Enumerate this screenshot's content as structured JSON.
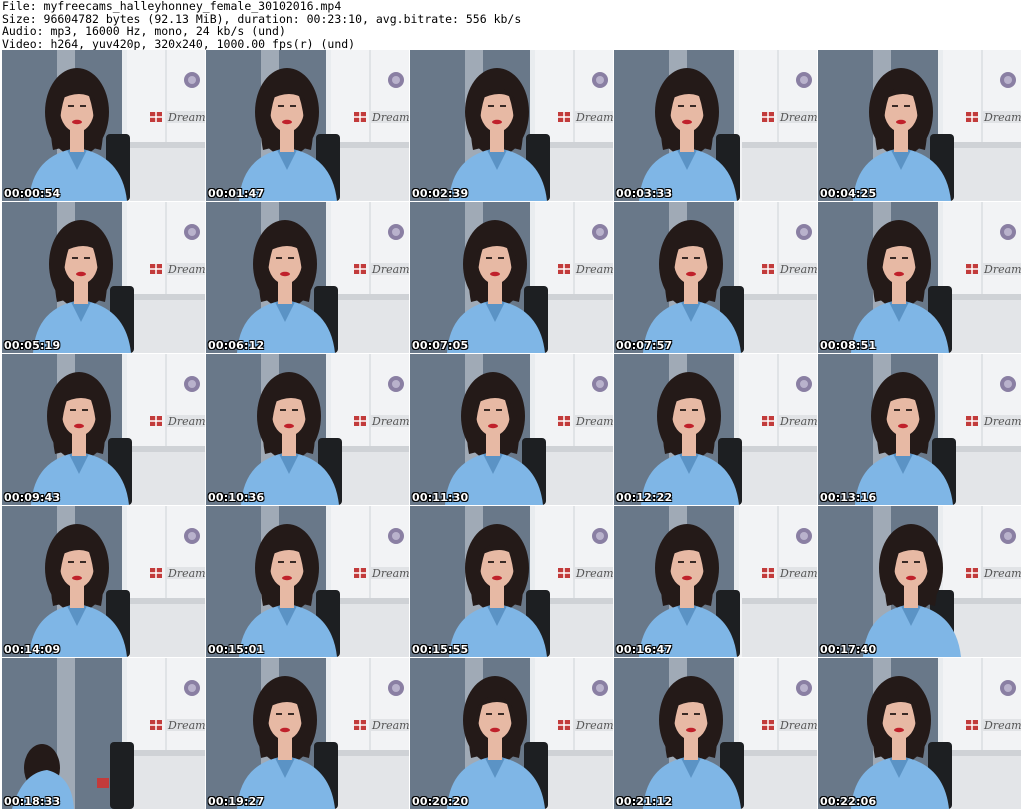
{
  "header": {
    "file": "File: myfreecams_halleyhonney_female_30102016.mp4",
    "size": "Size: 96604782 bytes (92.13 MiB), duration: 00:23:10, avg.bitrate: 556 kb/s",
    "audio": "Audio: mp3, 16000 Hz, mono, 24 kb/s (und)",
    "video": "Video: h264, yuv420p, 320x240, 1000.00 fps(r) (und)"
  },
  "thumbnails": [
    {
      "timestamp": "00:00:54",
      "icon": "webcam-frame"
    },
    {
      "timestamp": "00:01:47",
      "icon": "webcam-frame"
    },
    {
      "timestamp": "00:02:39",
      "icon": "webcam-frame"
    },
    {
      "timestamp": "00:03:33",
      "icon": "webcam-frame"
    },
    {
      "timestamp": "00:04:25",
      "icon": "webcam-frame"
    },
    {
      "timestamp": "00:05:19",
      "icon": "webcam-frame"
    },
    {
      "timestamp": "00:06:12",
      "icon": "webcam-frame"
    },
    {
      "timestamp": "00:07:05",
      "icon": "webcam-frame"
    },
    {
      "timestamp": "00:07:57",
      "icon": "webcam-frame"
    },
    {
      "timestamp": "00:08:51",
      "icon": "webcam-frame"
    },
    {
      "timestamp": "00:09:43",
      "icon": "webcam-frame"
    },
    {
      "timestamp": "00:10:36",
      "icon": "webcam-frame"
    },
    {
      "timestamp": "00:11:30",
      "icon": "webcam-frame"
    },
    {
      "timestamp": "00:12:22",
      "icon": "webcam-frame"
    },
    {
      "timestamp": "00:13:16",
      "icon": "webcam-frame"
    },
    {
      "timestamp": "00:14:09",
      "icon": "webcam-frame"
    },
    {
      "timestamp": "00:15:01",
      "icon": "webcam-frame"
    },
    {
      "timestamp": "00:15:55",
      "icon": "webcam-frame"
    },
    {
      "timestamp": "00:16:47",
      "icon": "webcam-frame"
    },
    {
      "timestamp": "00:17:40",
      "icon": "webcam-frame"
    },
    {
      "timestamp": "00:18:33",
      "icon": "webcam-frame"
    },
    {
      "timestamp": "00:19:27",
      "icon": "webcam-frame"
    },
    {
      "timestamp": "00:20:20",
      "icon": "webcam-frame"
    },
    {
      "timestamp": "00:21:12",
      "icon": "webcam-frame"
    },
    {
      "timestamp": "00:22:06",
      "icon": "webcam-frame"
    }
  ],
  "colors": {
    "wall": "#5f6f82",
    "wall_light": "#e9ecef",
    "shirt": "#7fb6e6",
    "hair": "#241a18",
    "skin": "#e7b9a4",
    "chair": "#1d1f22"
  }
}
